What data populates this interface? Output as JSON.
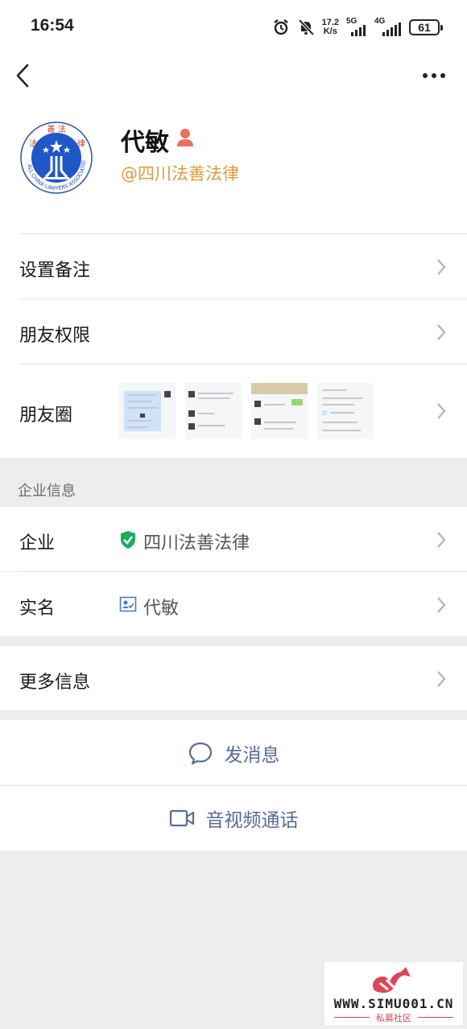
{
  "status_bar": {
    "time": "16:54",
    "net_speed_value": "17.2",
    "net_speed_unit": "K/s",
    "network_5g": "5G",
    "network_4g": "4G",
    "battery": "61"
  },
  "profile": {
    "name": "代敏",
    "corp_label": "@四川法善法律",
    "avatar_logo_text": "ALL CHINA LAWYERS ASSOCIATION",
    "avatar_top_text": "善 法 律"
  },
  "rows": {
    "remark_label": "设置备注",
    "permissions_label": "朋友权限",
    "moments_label": "朋友圈"
  },
  "enterprise": {
    "section_title": "企业信息",
    "company_label": "企业",
    "company_value": "四川法善法律",
    "realname_label": "实名",
    "realname_value": "代敏"
  },
  "more_info": {
    "label": "更多信息"
  },
  "actions": {
    "message_label": "发消息",
    "call_label": "音视频通话"
  },
  "watermark": {
    "text": "WWW.SIMU001.CN",
    "sub": "私募社区"
  },
  "colors": {
    "link_blue": "#576b95",
    "corp_orange": "#e09b3d",
    "verified_green": "#1aad5a"
  }
}
